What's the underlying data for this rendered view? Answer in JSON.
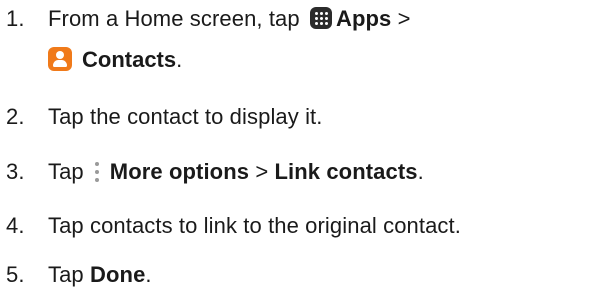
{
  "steps": [
    {
      "number": "1.",
      "text_before": "From a Home screen, tap",
      "apps_label": "Apps",
      "separator": ">",
      "contacts_label": "Contacts",
      "end": ".",
      "icons": [
        "apps-grid-icon",
        "contacts-icon"
      ]
    },
    {
      "number": "2.",
      "text": "Tap the contact to display it."
    },
    {
      "number": "3.",
      "text_before": "Tap",
      "more_label": "More options",
      "separator": ">",
      "link_label": "Link contacts",
      "end": ".",
      "icons": [
        "more-options-icon"
      ]
    },
    {
      "number": "4.",
      "text": "Tap contacts to link to the original contact."
    },
    {
      "number": "5.",
      "text_before": "Tap",
      "done_label": "Done",
      "end": "."
    }
  ],
  "colors": {
    "text": "#1a1a1a",
    "apps_icon_bg": "#2b2b2b",
    "contacts_icon_bg": "#f07a1a",
    "more_icon_dots": "#9a9a9a"
  }
}
